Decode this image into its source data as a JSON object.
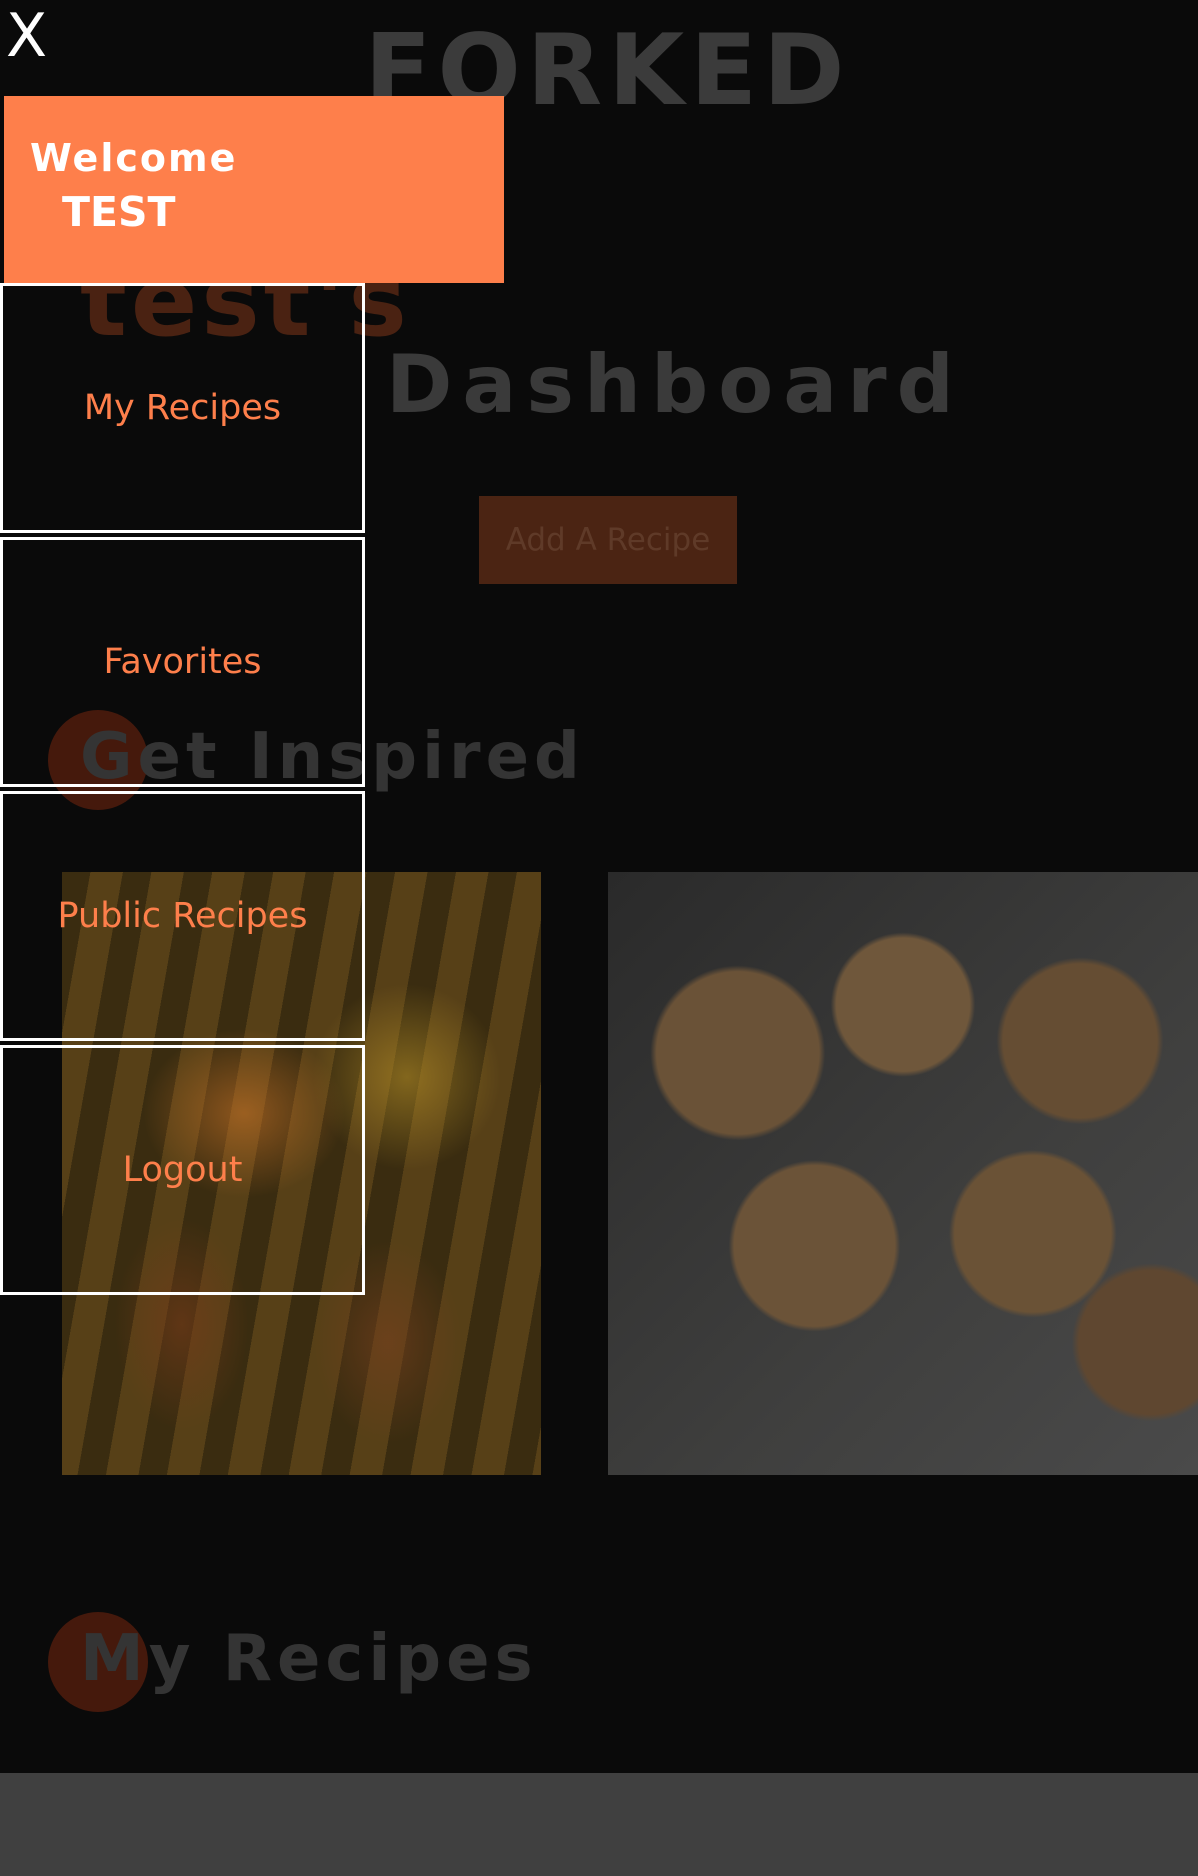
{
  "header": {
    "brand": "FORKED",
    "user_title": "test's",
    "dashboard_title": "Dashboard",
    "add_button": "Add A Recipe"
  },
  "sections": {
    "inspired_title": "Get Inspired",
    "my_recipes_title": "My Recipes"
  },
  "drawer": {
    "close_label": "X",
    "welcome_label": "Welcome",
    "user_name": "TEST",
    "items": [
      {
        "label": "My Recipes"
      },
      {
        "label": "Favorites"
      },
      {
        "label": "Public Recipes"
      },
      {
        "label": "Logout"
      }
    ]
  },
  "colors": {
    "accent": "#fe7f4b",
    "background": "#0a0a0a",
    "footer": "#404040"
  }
}
